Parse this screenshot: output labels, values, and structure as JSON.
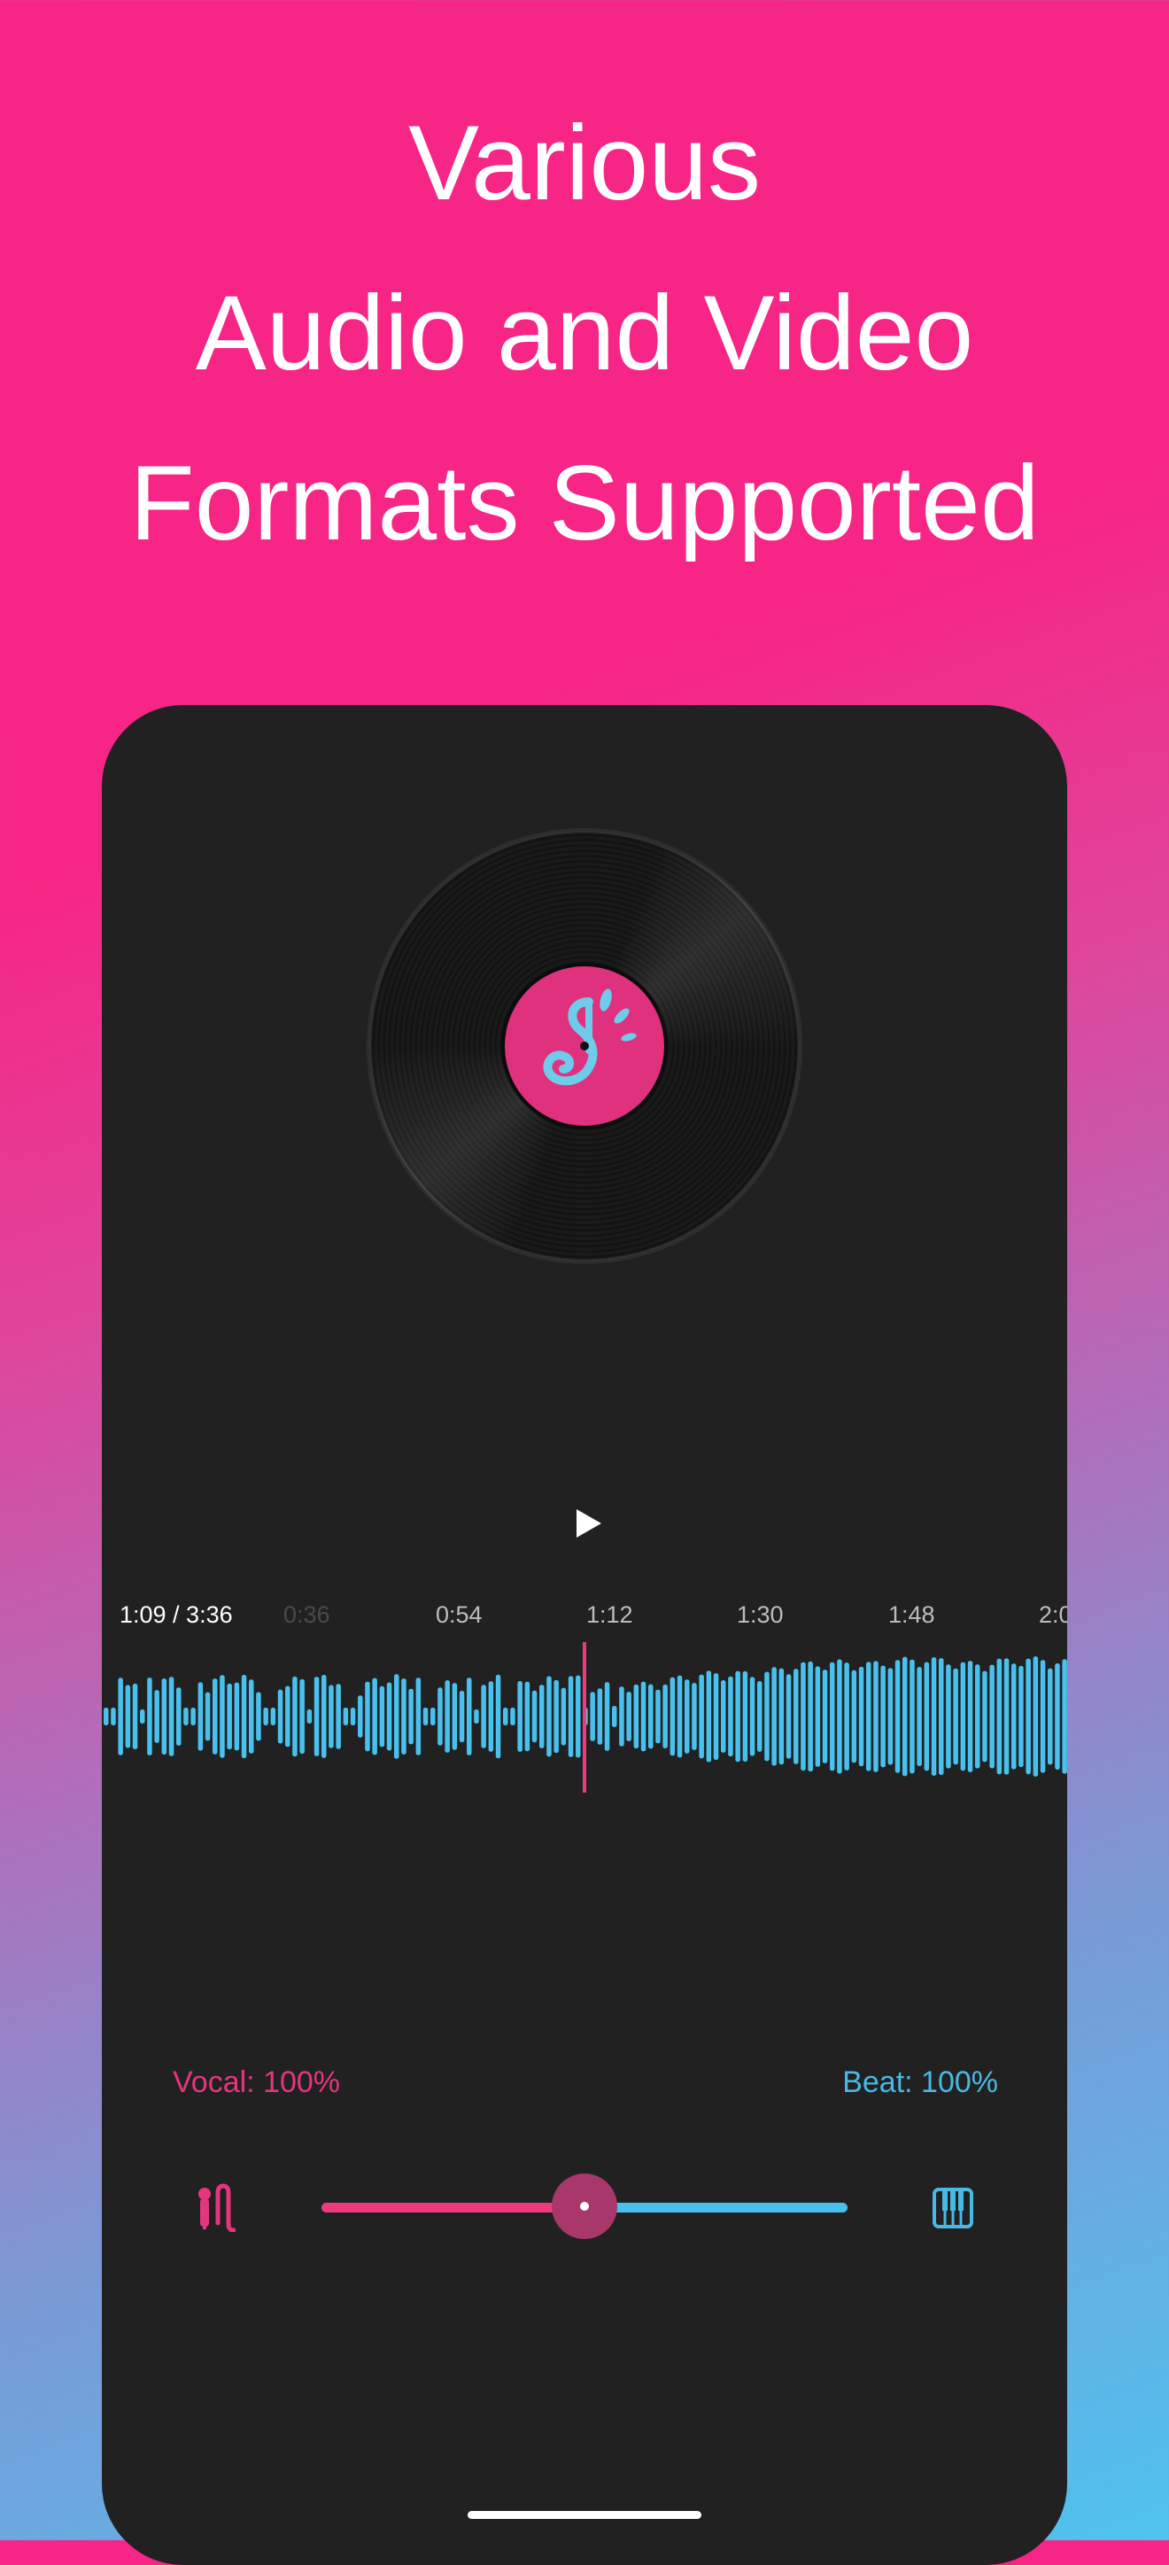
{
  "headline": {
    "line1": "Various",
    "line2": "Audio and Video",
    "line3": "Formats Supported"
  },
  "player": {
    "play_icon": "play-icon",
    "current_time": "1:09 / 3:36",
    "timeline_ticks": [
      "0:36",
      "0:54",
      "1:12",
      "1:30",
      "1:48",
      "2:0"
    ],
    "playhead_color": "#f0397f",
    "waveform_color": "#49c1ee"
  },
  "mix": {
    "vocal_label": "Vocal: 100%",
    "beat_label": "Beat: 100%",
    "balance_fraction": 0.5,
    "vocal_icon": "microphone-icon",
    "beat_icon": "piano-icon",
    "vocal_color": "#f0397f",
    "beat_color": "#49c1ee"
  },
  "colors": {
    "accent_pink": "#f72585",
    "accent_blue": "#4fc3ee",
    "panel_bg": "#212121"
  }
}
